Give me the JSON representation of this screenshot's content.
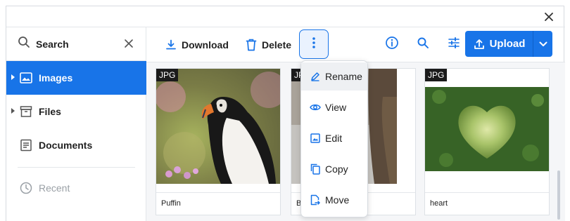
{
  "colors": {
    "accent": "#1874e8",
    "sidebar_active_bg": "#1874e8",
    "badge_bg": "#1b1b1b"
  },
  "window": {
    "close_icon": "close-icon"
  },
  "sidebar": {
    "search": {
      "label": "Search",
      "icon": "search-icon",
      "clear_icon": "close-icon"
    },
    "items": [
      {
        "label": "Images",
        "icon": "image-icon",
        "active": true,
        "expandable": true
      },
      {
        "label": "Files",
        "icon": "archive-icon",
        "active": false,
        "expandable": true
      },
      {
        "label": "Documents",
        "icon": "document-icon",
        "active": false,
        "expandable": false
      },
      {
        "label": "Recent",
        "icon": "clock-icon",
        "active": false,
        "disabled": true
      }
    ]
  },
  "toolbar": {
    "download_label": "Download",
    "delete_label": "Delete",
    "more_icon": "more-vertical-icon",
    "info_icon": "info-icon",
    "search_icon": "search-icon",
    "filter_icon": "sliders-icon",
    "upload_label": "Upload",
    "upload_dropdown_icon": "chevron-down-icon"
  },
  "context_menu": {
    "items": [
      {
        "label": "Rename",
        "icon": "pencil-icon",
        "hovered": true
      },
      {
        "label": "View",
        "icon": "eye-icon"
      },
      {
        "label": "Edit",
        "icon": "image-edit-icon"
      },
      {
        "label": "Copy",
        "icon": "copy-icon"
      },
      {
        "label": "Move",
        "icon": "move-file-icon"
      }
    ]
  },
  "files": [
    {
      "badge": "JPG",
      "name": "Puffin"
    },
    {
      "badge": "JPG",
      "name": "B"
    },
    {
      "badge": "JPG",
      "name": "heart"
    }
  ]
}
